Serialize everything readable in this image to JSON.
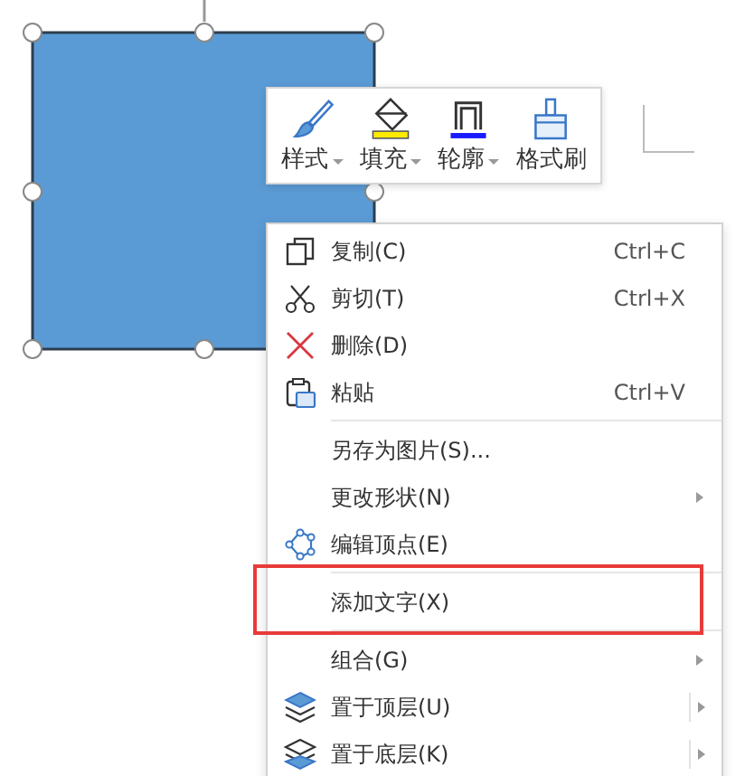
{
  "toolbar": [
    {
      "label": "样式",
      "dropdown": true
    },
    {
      "label": "填充",
      "dropdown": true
    },
    {
      "label": "轮廓",
      "dropdown": true
    },
    {
      "label": "格式刷",
      "dropdown": false
    }
  ],
  "context_menu": [
    {
      "label": "复制(C)",
      "shortcut": "Ctrl+C",
      "submenu": false,
      "split": false,
      "separator_before": false,
      "highlighted": false
    },
    {
      "label": "剪切(T)",
      "shortcut": "Ctrl+X",
      "submenu": false,
      "split": false,
      "separator_before": false,
      "highlighted": false
    },
    {
      "label": "删除(D)",
      "submenu": false,
      "split": false,
      "separator_before": false,
      "highlighted": false
    },
    {
      "label": "粘贴",
      "shortcut": "Ctrl+V",
      "submenu": false,
      "split": false,
      "separator_before": false,
      "highlighted": false
    },
    {
      "label": "另存为图片(S)...",
      "submenu": false,
      "split": false,
      "separator_before": true,
      "highlighted": false
    },
    {
      "label": "更改形状(N)",
      "submenu": true,
      "split": false,
      "separator_before": false,
      "highlighted": false
    },
    {
      "label": "编辑顶点(E)",
      "submenu": false,
      "split": false,
      "separator_before": false,
      "highlighted": false
    },
    {
      "label": "添加文字(X)",
      "submenu": false,
      "split": false,
      "separator_before": true,
      "highlighted": true
    },
    {
      "label": "组合(G)",
      "submenu": true,
      "split": false,
      "separator_before": true,
      "highlighted": false
    },
    {
      "label": "置于顶层(U)",
      "submenu": true,
      "split": true,
      "separator_before": false,
      "highlighted": false
    },
    {
      "label": "置于底层(K)",
      "submenu": true,
      "split": true,
      "separator_before": false,
      "highlighted": false
    }
  ]
}
